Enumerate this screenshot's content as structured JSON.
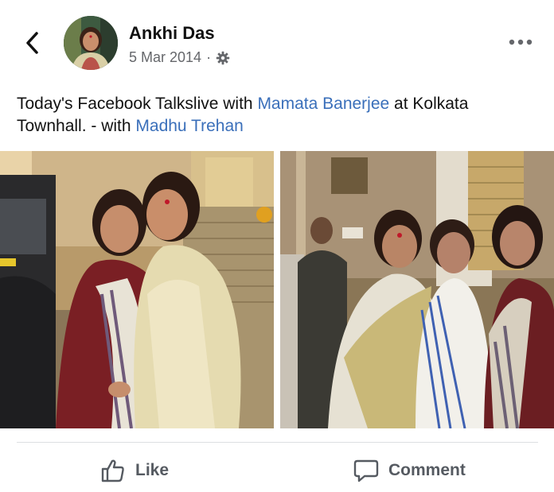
{
  "post": {
    "author": "Ankhi Das",
    "date": "5 Mar 2014",
    "separator": "·",
    "privacy_icon": "gear-icon",
    "text_parts": {
      "t1": "Today's Facebook Talkslive with ",
      "m1": "Mamata Banerjee",
      "t2": " at Kolkata Townhall. - with ",
      "m2": "Madhu Trehan"
    }
  },
  "actions": {
    "like_label": "Like",
    "comment_label": "Comment"
  },
  "colors": {
    "mention": "#3a6fba",
    "meta": "#65676b",
    "action": "#555a61"
  }
}
